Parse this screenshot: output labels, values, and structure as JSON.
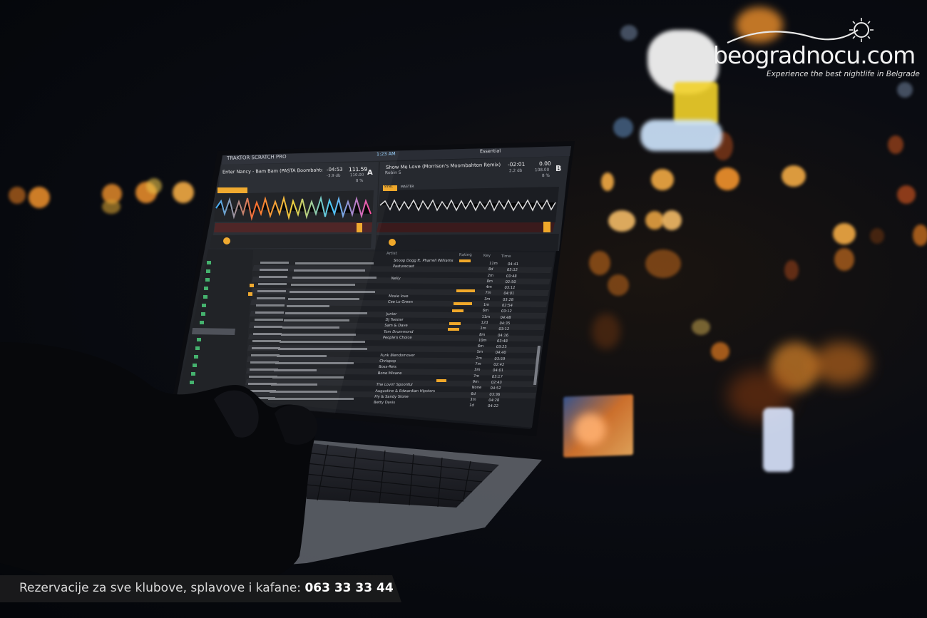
{
  "brand": {
    "name": "beogradnocu.com",
    "tagline": "Experience the best nightlife in Belgrade"
  },
  "banner": {
    "text": "Rezervacije za sve klubove, splavove i kafane: ",
    "phone": "063 33 33 44"
  },
  "screen": {
    "app_title": "TRAKTOR SCRATCH PRO",
    "top_time": "1:23 AM",
    "preset": "Essential",
    "deck_a": {
      "letter": "A",
      "track": "Enter Nancy - Bam Bam (PASTA Boombahton bo",
      "remaining": "-04:53",
      "bpm": "111.59",
      "gain": "-3.9 db",
      "base_bpm": "110.00",
      "pct": "8 %"
    },
    "deck_b": {
      "letter": "B",
      "track": "Show Me Love (Morrison's Moombahton Remix)",
      "artist": "Robin S",
      "remaining": "-02:01",
      "bpm": "0.00",
      "gain": "2.2 db",
      "base_bpm": "108.00",
      "pct": "8 %",
      "sync": "SYNC",
      "master": "MASTER"
    },
    "columns": [
      "Artist",
      "Rating",
      "Key",
      "Time"
    ],
    "artists": [
      "Snoop Dogg ft. Pharrell Williams",
      "Pasturecast",
      "",
      "Nelly",
      "",
      "",
      "Mosie love",
      "Cee Lo Green",
      "",
      "Junior",
      "DJ Twister",
      "Sam & Dave",
      "Tom Drummond",
      "People's Choice",
      "",
      "",
      "Funk Blendomover",
      "Chrispop",
      "Boss-Reis",
      "Bone Mixane",
      "",
      "The Lovin' Spoonful",
      "Augustine & Edwardian Hipsters",
      "Fly & Sandy Stone",
      "Betty Davis"
    ],
    "times": [
      "04:41",
      "03:12",
      "03:48",
      "02:50",
      "03:12",
      "04:01",
      "03:28",
      "02:54",
      "03:12",
      "04:48",
      "04:35",
      "03:12",
      "04:16",
      "03:48",
      "03:25",
      "04:40",
      "03:59",
      "02:42",
      "04:01",
      "03:17",
      "02:43",
      "04:52",
      "03:36",
      "04:28",
      "04:22"
    ],
    "keys": [
      "11m",
      "8d",
      "2m",
      "8m",
      "4m",
      "7m",
      "3m",
      "1m",
      "6m",
      "11m",
      "12d",
      "1m",
      "8m",
      "10m",
      "6m",
      "5m",
      "2m",
      "7m",
      "3m",
      "7m",
      "9m",
      "None",
      "6d",
      "3m",
      "1d"
    ]
  },
  "bokeh": [
    {
      "color": "#ffb347"
    },
    {
      "color": "#ff9a2e"
    },
    {
      "color": "#ffc46b"
    }
  ]
}
